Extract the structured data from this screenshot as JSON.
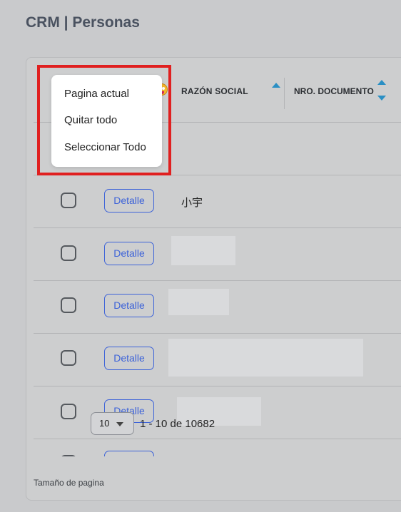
{
  "page": {
    "title": "CRM | Personas"
  },
  "table": {
    "columns": {
      "razon_social": "RAZÓN SOCIAL",
      "nro_documento": "NRO. DOCUMENTO"
    },
    "detail_label": "Detalle",
    "rows": [
      {
        "name": ""
      },
      {
        "name": "小宇"
      },
      {
        "name": ""
      },
      {
        "name": ""
      },
      {
        "name": ""
      },
      {
        "name": ""
      }
    ]
  },
  "select_menu": {
    "items": [
      "Pagina actual",
      "Quitar todo",
      "Seleccionar Todo"
    ]
  },
  "footer": {
    "page_size_label": "Tamaño de pagina",
    "page_size_value": "10",
    "range": "1 - 10 de 10682"
  },
  "colors": {
    "highlight": "#e02020",
    "accent": "#3d63d8",
    "sort_arrow": "#2a8fc4"
  }
}
